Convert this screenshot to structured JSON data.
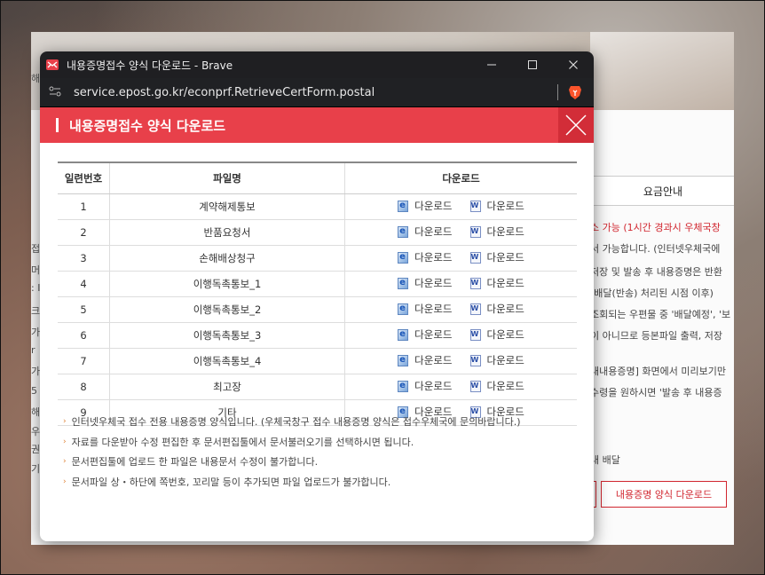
{
  "background_page": {
    "tab_label": "요금안내",
    "right_lines": [
      {
        "text": "소 가능 (1시간 경과시 우체국창",
        "red": true
      },
      {
        "text": "서 가능합니다. (인터넷우체국에",
        "red": false
      },
      {
        "text": "저장 및 발송 후 내용증명은 반환",
        "red": false
      },
      {
        "text": "[배달(반송) 처리된 시점 이후)",
        "red": false
      },
      {
        "text": "조회되는 우편물 중 '배달예정', '보",
        "red": false
      },
      {
        "text": "이 아니므로 등본파일 출력, 저장",
        "red": false
      },
      {
        "text": "내내용증명] 화면에서 미리보기만",
        "red": false
      },
      {
        "text": "수령을 원하시면 '발송 후 내용증",
        "red": false
      },
      {
        "text": "내 배달",
        "red": false
      }
    ],
    "left_fragments": [
      "해",
      "접",
      "머",
      ": I",
      "크",
      "가",
      "r",
      "가",
      "5",
      "해",
      "우",
      "권",
      "기"
    ],
    "button_label": "내용증명 양식 다운로드"
  },
  "window": {
    "title": "내용증명접수 양식 다운로드 - Brave",
    "url": "service.epost.go.kr/econprf.RetrieveCertForm.postal",
    "minimize_glyph": "—",
    "maximize_glyph": "☐",
    "close_glyph": "✕"
  },
  "popup": {
    "title": "내용증명접수 양식 다운로드",
    "columns": [
      "일련번호",
      "파일명",
      "다운로드"
    ],
    "download_label": "다운로드",
    "rows": [
      {
        "no": "1",
        "name": "계약해제통보"
      },
      {
        "no": "2",
        "name": "반품요청서"
      },
      {
        "no": "3",
        "name": "손해배상청구"
      },
      {
        "no": "4",
        "name": "이행독촉통보_1"
      },
      {
        "no": "5",
        "name": "이행독촉통보_2"
      },
      {
        "no": "6",
        "name": "이행독촉통보_3"
      },
      {
        "no": "7",
        "name": "이행독촉통보_4"
      },
      {
        "no": "8",
        "name": "최고장"
      },
      {
        "no": "9",
        "name": "기타"
      }
    ],
    "notes": [
      "인터넷우체국 접수 전용 내용증명 양식입니다. (우체국창구 접수 내용증명 양식은 접수우체국에 문의바랍니다.)",
      "자료를 다운받아 수정 편집한 후 문서편집툴에서 문서불러오기를 선택하시면 됩니다.",
      "문서편집툴에 업로드 한 파일은 내용문서 수정이 불가합니다.",
      "문서파일 상・하단에 쪽번호, 꼬리말 등이 추가되면 파일 업로드가 불가합니다."
    ],
    "note_bullet": "›"
  },
  "colors": {
    "accent_red": "#e8404a",
    "titlebar": "#1f1f22"
  }
}
